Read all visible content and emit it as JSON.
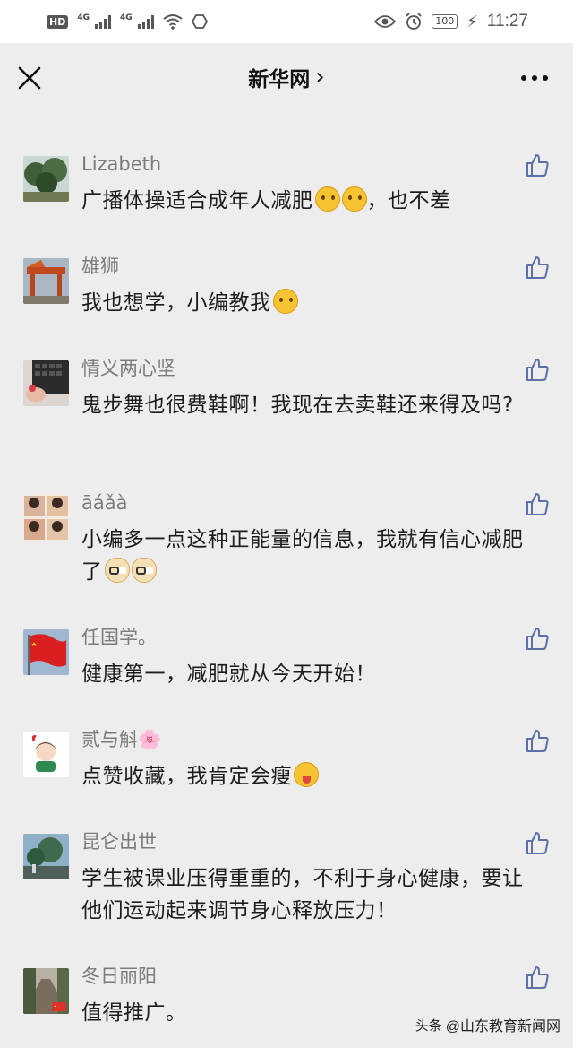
{
  "status_bar": {
    "network_1": "4G",
    "network_2": "4G",
    "battery": "100",
    "time": "11:27"
  },
  "nav": {
    "title": "新华网",
    "chevron": "›"
  },
  "comments": [
    {
      "name": "Lizabeth",
      "text": "广播体操适合成年人减肥",
      "emojis": [
        "thinking",
        "thinking"
      ],
      "text_after": "，也不差",
      "avatar": "trees"
    },
    {
      "name": "雄狮",
      "text": "我也想学，小编教我",
      "emojis": [
        "thinking"
      ],
      "text_after": "",
      "avatar": "crane"
    },
    {
      "name": "情义两心坚",
      "text": "鬼步舞也很费鞋啊！我现在去卖鞋还来得及吗?",
      "emojis": [],
      "text_after": "",
      "avatar": "keyboard"
    },
    {
      "name": "āáǎà",
      "text": "小编多一点这种正能量的信息，我就有信心减肥了",
      "emojis": [
        "doge",
        "doge"
      ],
      "text_after": "",
      "avatar": "collage"
    },
    {
      "name": "任国学。",
      "text": "健康第一，减肥就从今天开始！",
      "emojis": [],
      "text_after": "",
      "avatar": "flag"
    },
    {
      "name": "贰与斛🌸",
      "text": "点赞收藏，我肯定会瘦",
      "emojis": [
        "wink"
      ],
      "text_after": "",
      "avatar": "cartoon"
    },
    {
      "name": "昆仑出世",
      "text": "学生被课业压得重重的，不利于身心健康，要让他们运动起来调节身心释放压力！",
      "emojis": [],
      "text_after": "",
      "avatar": "scenery"
    },
    {
      "name": "冬日丽阳",
      "text": "值得推广。",
      "emojis": [],
      "text_after": "",
      "avatar": "road"
    }
  ],
  "watermark": {
    "source": "头条",
    "account": "@山东教育新闻网"
  },
  "icons": {
    "close": "close-icon",
    "more": "more-icon",
    "like": "thumbs-up-icon"
  }
}
